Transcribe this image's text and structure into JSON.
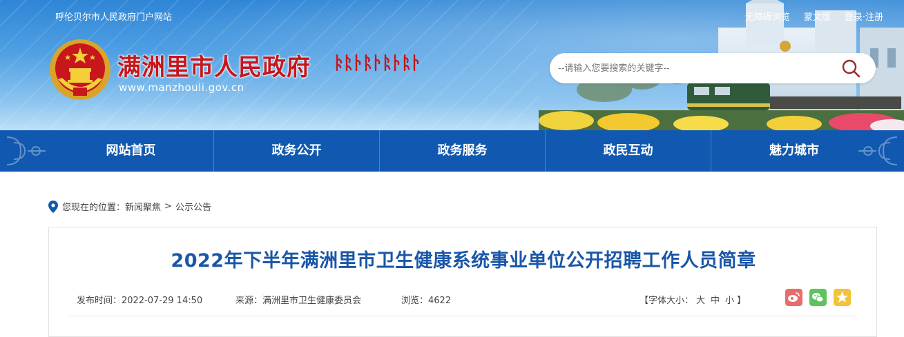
{
  "header": {
    "portal_link": "呼伦贝尔市人民政府门户网站",
    "top_links": [
      "无障碍浏览",
      "蒙文版",
      "登录",
      "注册"
    ],
    "site_name": "满洲里市人民政府",
    "site_url": "www.manzhouli.gov.cn",
    "search_placeholder": "--请输入您要搜索的关键字--",
    "icons": {
      "emblem": "national-emblem-icon",
      "search": "search-icon"
    }
  },
  "nav": {
    "items": [
      "网站首页",
      "政务公开",
      "政务服务",
      "政民互动",
      "魅力城市"
    ]
  },
  "breadcrumb": {
    "prefix": "您现在的位置：",
    "items": [
      "新闻聚焦",
      "公示公告"
    ],
    "separator": ">"
  },
  "article": {
    "title": "2022年下半年满洲里市卫生健康系统事业单位公开招聘工作人员简章",
    "publish_time": "发布时间：2022-07-29 14:50",
    "source": "来源：满洲里市卫生健康委员会",
    "views": "浏览：4622",
    "font_size_label": "【字体大小：",
    "font_size_options": [
      "大",
      "中",
      "小"
    ],
    "font_size_end": "】",
    "share_icons": [
      "weibo-icon",
      "wechat-icon",
      "favorite-icon"
    ]
  },
  "colors": {
    "nav_bg": "#1159b0",
    "title": "#1a56a8",
    "site_name": "#c4161c",
    "weibo": "#e86c6c",
    "wechat": "#5fc25f",
    "favorite": "#f2c23a"
  }
}
